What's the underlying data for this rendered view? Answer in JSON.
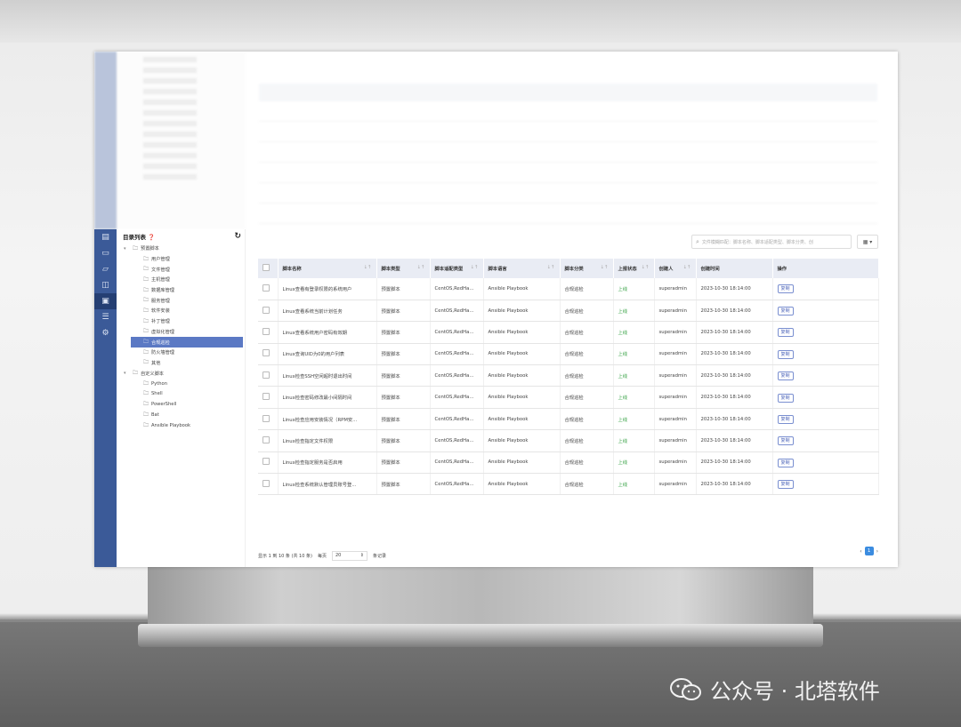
{
  "tree": {
    "title": "目录列表",
    "help_icon": "help-icon",
    "refresh_icon": "refresh-icon",
    "items": [
      {
        "label": "预置脚本",
        "level": 1
      },
      {
        "label": "用户管理",
        "level": 2
      },
      {
        "label": "文件管理",
        "level": 2
      },
      {
        "label": "主机管理",
        "level": 2
      },
      {
        "label": "数据库管理",
        "level": 2
      },
      {
        "label": "服务管理",
        "level": 2
      },
      {
        "label": "软件安装",
        "level": 2
      },
      {
        "label": "补丁管理",
        "level": 2
      },
      {
        "label": "虚拟化管理",
        "level": 2
      },
      {
        "label": "合规巡检",
        "level": 2,
        "selected": true
      },
      {
        "label": "防火墙管理",
        "level": 2
      },
      {
        "label": "其他",
        "level": 2
      },
      {
        "label": "自定义脚本",
        "level": 1
      },
      {
        "label": "Python",
        "level": 2
      },
      {
        "label": "Shell",
        "level": 2
      },
      {
        "label": "PowerShell",
        "level": 2
      },
      {
        "label": "Bat",
        "level": 2
      },
      {
        "label": "Ansible Playbook",
        "level": 2
      }
    ]
  },
  "search": {
    "placeholder": "文件模糊匹配：脚本名称、脚本适配类型、脚本分类、创"
  },
  "table": {
    "headers": [
      "脚本名称",
      "脚本类型",
      "脚本适配类型",
      "脚本语言",
      "脚本分类",
      "上报状态",
      "创建人",
      "创建时间",
      "操作"
    ],
    "rows": [
      [
        "Linux查看有登录权限的系统用户",
        "预置脚本",
        "CentOS,RedHa...",
        "Ansible Playbook",
        "合规巡检",
        "上线",
        "superadmin",
        "2023-10-30 18:14:00",
        "复制"
      ],
      [
        "Linux查看系统当前计划任务",
        "预置脚本",
        "CentOS,RedHa...",
        "Ansible Playbook",
        "合规巡检",
        "上线",
        "superadmin",
        "2023-10-30 18:14:00",
        "复制"
      ],
      [
        "Linux查看系统用户密码有效期",
        "预置脚本",
        "CentOS,RedHa...",
        "Ansible Playbook",
        "合规巡检",
        "上线",
        "superadmin",
        "2023-10-30 18:14:00",
        "复制"
      ],
      [
        "Linux查询UID为0的用户列表",
        "预置脚本",
        "CentOS,RedHa...",
        "Ansible Playbook",
        "合规巡检",
        "上线",
        "superadmin",
        "2023-10-30 18:14:00",
        "复制"
      ],
      [
        "Linux检查SSH空闲超时退出时间",
        "预置脚本",
        "CentOS,RedHa...",
        "Ansible Playbook",
        "合规巡检",
        "上线",
        "superadmin",
        "2023-10-30 18:14:00",
        "复制"
      ],
      [
        "Linux检查密码修改最小间隔时间",
        "预置脚本",
        "CentOS,RedHa...",
        "Ansible Playbook",
        "合规巡检",
        "上线",
        "superadmin",
        "2023-10-30 18:14:00",
        "复制"
      ],
      [
        "Linux检查应用安装情况（RPM安...",
        "预置脚本",
        "CentOS,RedHa...",
        "Ansible Playbook",
        "合规巡检",
        "上线",
        "superadmin",
        "2023-10-30 18:14:00",
        "复制"
      ],
      [
        "Linux检查指定文件权限",
        "预置脚本",
        "CentOS,RedHa...",
        "Ansible Playbook",
        "合规巡检",
        "上线",
        "superadmin",
        "2023-10-30 18:14:00",
        "复制"
      ],
      [
        "Linux检查指定服务是否启用",
        "预置脚本",
        "CentOS,RedHa...",
        "Ansible Playbook",
        "合规巡检",
        "上线",
        "superadmin",
        "2023-10-30 18:14:00",
        "复制"
      ],
      [
        "Linux检查系统默认管理员账号登...",
        "预置脚本",
        "CentOS,RedHa...",
        "Ansible Playbook",
        "合规巡检",
        "上线",
        "superadmin",
        "2023-10-30 18:14:00",
        "复制"
      ]
    ]
  },
  "footer": {
    "summary": "显示 1 到 10 条 (共 10 条)",
    "per_page_label": "每页",
    "page_size": "20",
    "records_label": "条记录"
  },
  "pager": {
    "prev": "‹",
    "current": "1",
    "next": "›"
  },
  "watermark": {
    "text": "公众号 · 北塔软件"
  },
  "colors": {
    "sidebar": "#3b5a98",
    "selected": "#5b79c4",
    "online": "#3aa347",
    "header": "#e9ecf4"
  }
}
